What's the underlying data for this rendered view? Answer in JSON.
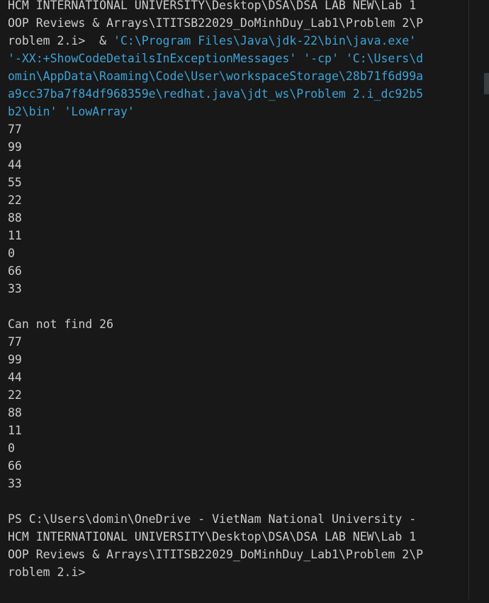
{
  "terminal": {
    "command_block": [
      {
        "text": "HCM INTERNATIONAL UNIVERSITY\\Desktop\\DSA\\DSA LAB NEW\\Lab 1",
        "color": "#cccccc"
      },
      {
        "text": "OOP Reviews & Arrays\\ITITSB22029_DoMinhDuy_Lab1\\Problem 2\\P",
        "color": "#cccccc"
      },
      {
        "text": "roblem 2.i>  & ",
        "color": "#cccccc",
        "cont": "'C:\\Program Files\\Java\\jdk-22\\bin\\java.exe'",
        "cont_color": "#3ea2d6"
      },
      {
        "text": "'-XX:+ShowCodeDetailsInExceptionMessages' '-cp' 'C:\\Users\\d",
        "color": "#3ea2d6"
      },
      {
        "text": "omin\\AppData\\Roaming\\Code\\User\\workspaceStorage\\28b71f6d99a",
        "color": "#3ea2d6"
      },
      {
        "text": "a9cc37ba7f84df968359e\\redhat.java\\jdt_ws\\Problem 2.i_dc92b5",
        "color": "#3ea2d6"
      },
      {
        "text": "b2\\bin' 'LowArray'",
        "color": "#3ea2d6"
      }
    ],
    "output_lines": [
      "77",
      "99",
      "44",
      "55",
      "22",
      "88",
      "11",
      "0",
      "66",
      "33",
      "",
      "Can not find 26",
      "77",
      "99",
      "44",
      "22",
      "88",
      "11",
      "0",
      "66",
      "33",
      ""
    ],
    "prompt_lines": [
      "PS C:\\Users\\domin\\OneDrive - VietNam National University -",
      "HCM INTERNATIONAL UNIVERSITY\\Desktop\\DSA\\DSA LAB NEW\\Lab 1",
      "OOP Reviews & Arrays\\ITITSB22029_DoMinhDuy_Lab1\\Problem 2\\P",
      "roblem 2.i>"
    ]
  }
}
